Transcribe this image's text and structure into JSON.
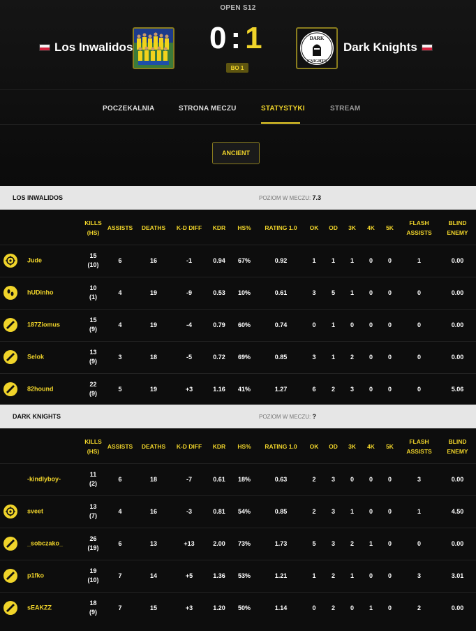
{
  "header": {
    "league": "OPEN S12",
    "team1": {
      "name": "Los Inwalidos"
    },
    "team2": {
      "name": "Dark Knights"
    },
    "score1": "0",
    "separator": ":",
    "score2": "1",
    "format": "BO 1",
    "team2_logo_text": [
      "DARK",
      "KNIGHTS"
    ]
  },
  "nav": {
    "tabs": [
      {
        "label": "POCZEKALNIA"
      },
      {
        "label": "STRONA MECZU"
      },
      {
        "label": "STATYSTYKI"
      },
      {
        "label": "STREAM"
      }
    ],
    "active_tab": "STATYSTYKI"
  },
  "map_button": "ANCIENT",
  "columns": [
    {
      "line1": "KILLS",
      "line2": "(HS)"
    },
    {
      "line1": "ASSISTS",
      "line2": ""
    },
    {
      "line1": "DEATHS",
      "line2": ""
    },
    {
      "line1": "K-D DIFF",
      "line2": ""
    },
    {
      "line1": "KDR",
      "line2": ""
    },
    {
      "line1": "HS%",
      "line2": ""
    },
    {
      "line1": "RATING 1.0",
      "line2": ""
    },
    {
      "line1": "OK",
      "line2": ""
    },
    {
      "line1": "OD",
      "line2": ""
    },
    {
      "line1": "3K",
      "line2": ""
    },
    {
      "line1": "4K",
      "line2": ""
    },
    {
      "line1": "5K",
      "line2": ""
    },
    {
      "line1": "FLASH",
      "line2": "ASSISTS"
    },
    {
      "line1": "BLIND",
      "line2": "ENEMY"
    }
  ],
  "level_label": "POZIOM W MECZU:",
  "teams": [
    {
      "name": "LOS INWALIDOS",
      "level": "7.3",
      "players": [
        {
          "name": "Jude",
          "avatar": "crosshair-icon",
          "kills": "15",
          "hs": "(10)",
          "assists": "6",
          "deaths": "16",
          "kd_diff": "-1",
          "kdr": "0.94",
          "hs_pct": "67%",
          "rating": "0.92",
          "ok": "1",
          "od": "1",
          "k3": "1",
          "k4": "0",
          "k5": "0",
          "flash": "1",
          "blind": "0.00"
        },
        {
          "name": "hUDinho",
          "avatar": "footprints-icon",
          "kills": "10",
          "hs": "(1)",
          "assists": "4",
          "deaths": "19",
          "kd_diff": "-9",
          "kdr": "0.53",
          "hs_pct": "10%",
          "rating": "0.61",
          "ok": "3",
          "od": "5",
          "k3": "1",
          "k4": "0",
          "k5": "0",
          "flash": "0",
          "blind": "0.00"
        },
        {
          "name": "187Ziomus",
          "avatar": "slash-icon",
          "kills": "15",
          "hs": "(9)",
          "assists": "4",
          "deaths": "19",
          "kd_diff": "-4",
          "kdr": "0.79",
          "hs_pct": "60%",
          "rating": "0.74",
          "ok": "0",
          "od": "1",
          "k3": "0",
          "k4": "0",
          "k5": "0",
          "flash": "0",
          "blind": "0.00"
        },
        {
          "name": "Selok",
          "avatar": "slash-icon",
          "kills": "13",
          "hs": "(9)",
          "assists": "3",
          "deaths": "18",
          "kd_diff": "-5",
          "kdr": "0.72",
          "hs_pct": "69%",
          "rating": "0.85",
          "ok": "3",
          "od": "1",
          "k3": "2",
          "k4": "0",
          "k5": "0",
          "flash": "0",
          "blind": "0.00"
        },
        {
          "name": "82hound",
          "avatar": "slash-icon",
          "kills": "22",
          "hs": "(9)",
          "assists": "5",
          "deaths": "19",
          "kd_diff": "+3",
          "kdr": "1.16",
          "hs_pct": "41%",
          "rating": "1.27",
          "ok": "6",
          "od": "2",
          "k3": "3",
          "k4": "0",
          "k5": "0",
          "flash": "0",
          "blind": "5.06"
        }
      ]
    },
    {
      "name": "DARK KNIGHTS",
      "level": "?",
      "players": [
        {
          "name": "-kindlyboy-",
          "avatar": "",
          "kills": "11",
          "hs": "(2)",
          "assists": "6",
          "deaths": "18",
          "kd_diff": "-7",
          "kdr": "0.61",
          "hs_pct": "18%",
          "rating": "0.63",
          "ok": "2",
          "od": "3",
          "k3": "0",
          "k4": "0",
          "k5": "0",
          "flash": "3",
          "blind": "0.00"
        },
        {
          "name": "sveet",
          "avatar": "crosshair-icon",
          "kills": "13",
          "hs": "(7)",
          "assists": "4",
          "deaths": "16",
          "kd_diff": "-3",
          "kdr": "0.81",
          "hs_pct": "54%",
          "rating": "0.85",
          "ok": "2",
          "od": "3",
          "k3": "1",
          "k4": "0",
          "k5": "0",
          "flash": "1",
          "blind": "4.50"
        },
        {
          "name": "_sobczako_",
          "avatar": "slash-icon",
          "kills": "26",
          "hs": "(19)",
          "assists": "6",
          "deaths": "13",
          "kd_diff": "+13",
          "kdr": "2.00",
          "hs_pct": "73%",
          "rating": "1.73",
          "ok": "5",
          "od": "3",
          "k3": "2",
          "k4": "1",
          "k5": "0",
          "flash": "0",
          "blind": "0.00"
        },
        {
          "name": "p1fko",
          "avatar": "slash-icon",
          "kills": "19",
          "hs": "(10)",
          "assists": "7",
          "deaths": "14",
          "kd_diff": "+5",
          "kdr": "1.36",
          "hs_pct": "53%",
          "rating": "1.21",
          "ok": "1",
          "od": "2",
          "k3": "1",
          "k4": "0",
          "k5": "0",
          "flash": "3",
          "blind": "3.01"
        },
        {
          "name": "sEAKZZ",
          "avatar": "slash-icon",
          "kills": "18",
          "hs": "(9)",
          "assists": "7",
          "deaths": "15",
          "kd_diff": "+3",
          "kdr": "1.20",
          "hs_pct": "50%",
          "rating": "1.14",
          "ok": "0",
          "od": "2",
          "k3": "0",
          "k4": "1",
          "k5": "0",
          "flash": "2",
          "blind": "0.00"
        }
      ]
    }
  ],
  "colors": {
    "accent": "#f0d42a",
    "background": "#0d0d0d",
    "header_bg": "#e6e6e6"
  }
}
